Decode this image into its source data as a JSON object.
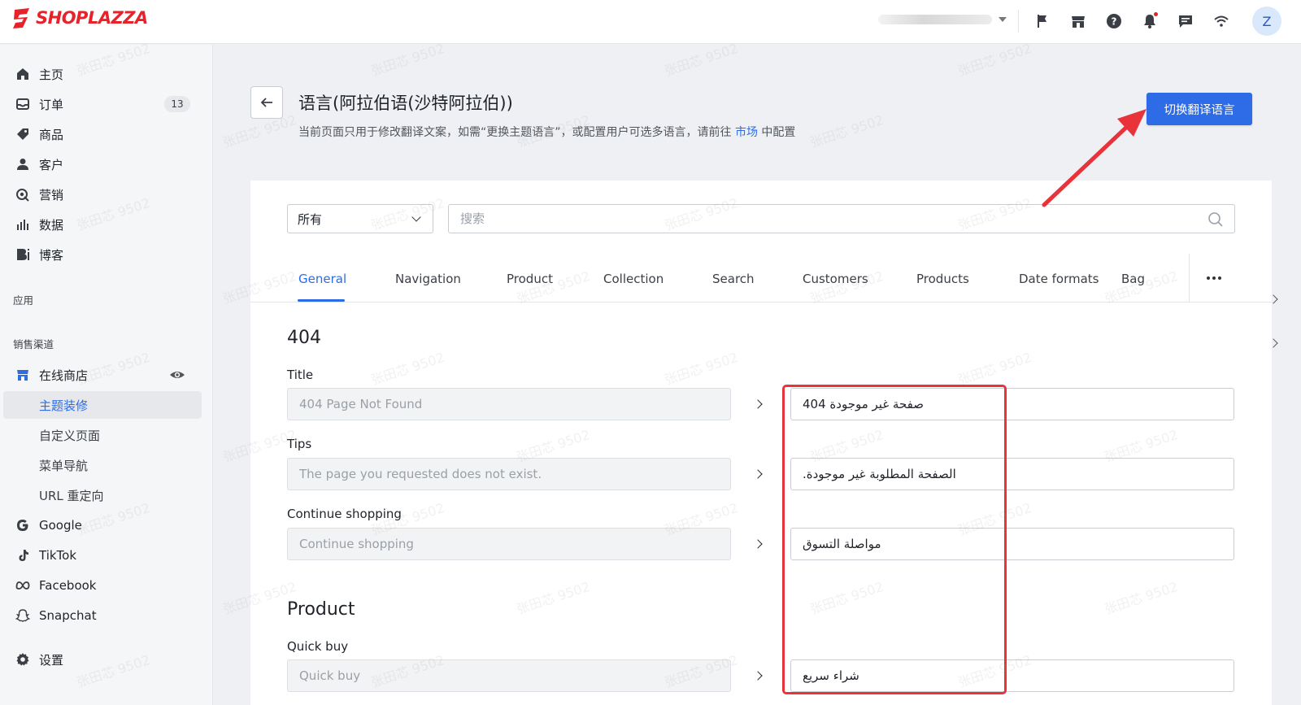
{
  "brand": {
    "logo_text": "SHOPLAZZA",
    "color": "#e8222a"
  },
  "header": {
    "icons": [
      "flag-icon",
      "store-icon",
      "help-icon",
      "bell-icon",
      "message-icon",
      "wifi-icon"
    ],
    "avatar_initial": "Z"
  },
  "sidebar": {
    "items": [
      {
        "label": "主页",
        "icon": "home-icon"
      },
      {
        "label": "订单",
        "icon": "inbox-icon",
        "badge": "13"
      },
      {
        "label": "商品",
        "icon": "tag-icon"
      },
      {
        "label": "客户",
        "icon": "user-icon"
      },
      {
        "label": "营销",
        "icon": "marketing-icon"
      },
      {
        "label": "数据",
        "icon": "chart-icon"
      },
      {
        "label": "博客",
        "icon": "blog-icon"
      }
    ],
    "apps_label": "应用",
    "channels_label": "销售渠道",
    "online_store": "在线商店",
    "store_sub": [
      "主题装修",
      "自定义页面",
      "菜单导航",
      "URL 重定向"
    ],
    "channels": [
      {
        "label": "Google",
        "icon": "google-icon"
      },
      {
        "label": "TikTok",
        "icon": "tiktok-icon"
      },
      {
        "label": "Facebook",
        "icon": "meta-icon"
      },
      {
        "label": "Snapchat",
        "icon": "snapchat-icon"
      }
    ],
    "settings": "设置"
  },
  "page": {
    "title": "语言(阿拉伯语(沙特阿拉伯))",
    "subtitle_before": "当前页面只用于修改翻译文案，如需“更换主题语言”，或配置用户可选多语言，请前往",
    "subtitle_link": "市场",
    "subtitle_after": "中配置",
    "switch_button": "切换翻译语言"
  },
  "filters": {
    "select_value": "所有",
    "search_placeholder": "搜索"
  },
  "tabs": [
    "General",
    "Navigation",
    "Product",
    "Collection",
    "Search",
    "Customers",
    "Products",
    "Date formats",
    "Bag"
  ],
  "sections": [
    {
      "title": "404",
      "fields": [
        {
          "label": "Title",
          "source": "404 Page Not Found",
          "translation": "صفحة غير موجودة 404"
        },
        {
          "label": "Tips",
          "source": "The page you requested does not exist.",
          "translation": "الصفحة المطلوبة غير موجودة."
        },
        {
          "label": "Continue shopping",
          "source": "Continue shopping",
          "translation": "مواصلة التسوق"
        }
      ]
    },
    {
      "title": "Product",
      "fields": [
        {
          "label": "Quick buy",
          "source": "Quick buy",
          "translation": "شراء سريع"
        }
      ]
    }
  ],
  "watermark": "张田芯 9502",
  "colors": {
    "accent": "#2e6be6",
    "annotation": "#e8333a"
  }
}
